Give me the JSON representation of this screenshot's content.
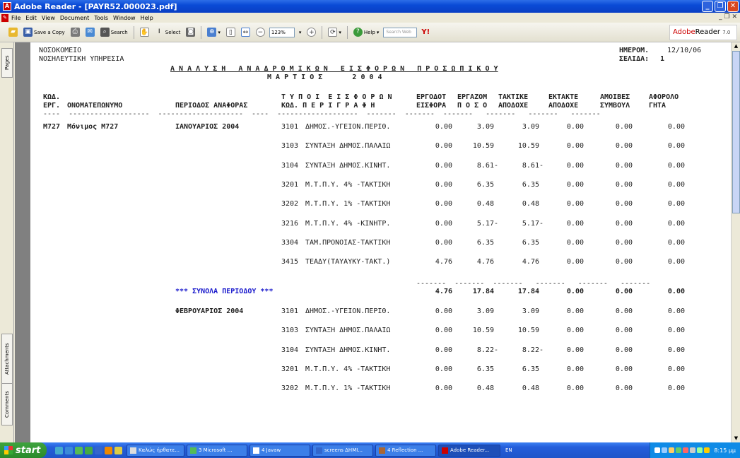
{
  "window": {
    "title": "Adobe Reader - [PAYR52.000023.pdf]",
    "buttons": {
      "minimize": "_",
      "maximize": "❐",
      "close": "✕"
    }
  },
  "menu": {
    "items": [
      "File",
      "Edit",
      "View",
      "Document",
      "Tools",
      "Window",
      "Help"
    ],
    "right_controls": "_ ❐ ✕"
  },
  "toolbar": {
    "save_copy": "Save a Copy",
    "search": "Search",
    "select": "Select",
    "zoom_value": "123%",
    "help": "Help",
    "search_web_placeholder": "Search Web",
    "brand": "Adobe",
    "brand_product": "Reader",
    "brand_version": "7.0"
  },
  "side_tabs": {
    "pages": "Pages",
    "attachments": "Attachments",
    "comments": "Comments"
  },
  "document": {
    "header_left_1": "ΝΟΣΟΚΟΜΕΙΟ",
    "header_left_2": "ΝΟΣΗΛΕΥΤΙΚΗ ΥΠΗΡΕΣΙΑ",
    "date_label": "ΗΜΕΡΟΜ.",
    "date_value": "12/10/06",
    "page_label": "ΣΕΛΙΔΑ:",
    "page_value": "1",
    "title": "Α Ν Α Λ Υ Σ Η   Α Ν Α Δ Ρ Ο Μ Ι Κ Ω Ν   Ε Ι Σ Φ Ο Ρ Ω Ν   Π Ρ Ο Σ Ω Π Ι Κ Ο Υ",
    "subtitle": "Μ Α Ρ Τ Ι Ο Σ       2 0 0 4",
    "col_headers": {
      "c1a": "ΚΩΔ.",
      "c1b": "ΕΡΓ.",
      "c2": "ΟΝΟΜΑΤΕΠΩΝΥΜΟ",
      "c3": "ΠΕΡΙΟΔΟΣ ΑΝΑΦΟΡΑΣ",
      "c4a": "Τ Υ Π Ο Ι  Ε Ι Σ Φ Ο Ρ Ω Ν",
      "c4b": "ΚΩΔ. Π Ε Ρ Ι Γ Ρ Α Φ Η",
      "c5a": "ΕΡΓΟΔΟΤ",
      "c5b": "ΕΙΣΦΟΡΑ",
      "c6a": "ΕΡΓΑΖΟΜ",
      "c6b": "Π Ο Σ Ο",
      "c7a": "ΤΑΚΤΙΚΕ",
      "c7b": "ΑΠΟΔΟΧΕ",
      "c8a": "ΕΚΤΑΚΤΕ",
      "c8b": "ΑΠΟΔΟΧΕ",
      "c9a": "ΑΜΟΙΒΕΣ",
      "c9b": "ΣΥΜΒΟΥΛ",
      "c10a": "ΑΦΟΡΟΛΟ",
      "c10b": "ΓΗΤΑ"
    },
    "dash_line": "----  -------------------  --------------------  ----  -------------------  -------  -------  -------   -------   -------   -------",
    "employee_code": "Μ727",
    "employee_name": "Μόνιμος Μ727",
    "period_1": "ΙΑΝΟΥΑΡΙΟΣ 2004",
    "period_2": "ΦΕΒΡΟΥΑΡΙΟΣ 2004",
    "rows_p1": [
      {
        "code": "3101",
        "desc": "ΔΗΜΟΣ.-ΥΓΕΙΟΝ.ΠΕΡΙΘ.",
        "erg": "0.00",
        "poso": "3.09",
        "takt": "3.09",
        "ekt": "0.00",
        "amoib": "0.00",
        "afor": "0.00"
      },
      {
        "code": "3103",
        "desc": "ΣΥΝΤΑΞΗ ΔΗΜΟΣ.ΠΑΛΑΙΩ",
        "erg": "0.00",
        "poso": "10.59",
        "takt": "10.59",
        "ekt": "0.00",
        "amoib": "0.00",
        "afor": "0.00"
      },
      {
        "code": "3104",
        "desc": "ΣΥΝΤΑΞΗ ΔΗΜΟΣ.ΚΙΝΗΤ.",
        "erg": "0.00",
        "poso": "8.61-",
        "takt": "8.61-",
        "ekt": "0.00",
        "amoib": "0.00",
        "afor": "0.00"
      },
      {
        "code": "3201",
        "desc": "Μ.Τ.Π.Υ. 4% -ΤΑΚΤΙΚΗ",
        "erg": "0.00",
        "poso": "6.35",
        "takt": "6.35",
        "ekt": "0.00",
        "amoib": "0.00",
        "afor": "0.00"
      },
      {
        "code": "3202",
        "desc": "Μ.Τ.Π.Υ. 1% -ΤΑΚΤΙΚΗ",
        "erg": "0.00",
        "poso": "0.48",
        "takt": "0.48",
        "ekt": "0.00",
        "amoib": "0.00",
        "afor": "0.00"
      },
      {
        "code": "3216",
        "desc": "Μ.Τ.Π.Υ. 4% -ΚΙΝΗΤΡ.",
        "erg": "0.00",
        "poso": "5.17-",
        "takt": "5.17-",
        "ekt": "0.00",
        "amoib": "0.00",
        "afor": "0.00"
      },
      {
        "code": "3304",
        "desc": "ΤΑΜ.ΠΡΟΝΟΙΑΣ-ΤΑΚΤΙΚΗ",
        "erg": "0.00",
        "poso": "6.35",
        "takt": "6.35",
        "ekt": "0.00",
        "amoib": "0.00",
        "afor": "0.00"
      },
      {
        "code": "3415",
        "desc": "ΤΕΑΔΥ(ΤΑΥΑΥΚΥ-ΤΑΚΤ.)",
        "erg": "4.76",
        "poso": "4.76",
        "takt": "4.76",
        "ekt": "0.00",
        "amoib": "0.00",
        "afor": "0.00"
      }
    ],
    "total_dashes": "-------  -------  -------   -------   -------   -------",
    "total_label": "*** ΣΥΝΟΛΑ ΠΕΡΙΟΔΟΥ ***",
    "totals": {
      "erg": "4.76",
      "poso": "17.84",
      "takt": "17.84",
      "ekt": "0.00",
      "amoib": "0.00",
      "afor": "0.00"
    },
    "rows_p2": [
      {
        "code": "3101",
        "desc": "ΔΗΜΟΣ.-ΥΓΕΙΟΝ.ΠΕΡΙΘ.",
        "erg": "0.00",
        "poso": "3.09",
        "takt": "3.09",
        "ekt": "0.00",
        "amoib": "0.00",
        "afor": "0.00"
      },
      {
        "code": "3103",
        "desc": "ΣΥΝΤΑΞΗ ΔΗΜΟΣ.ΠΑΛΑΙΩ",
        "erg": "0.00",
        "poso": "10.59",
        "takt": "10.59",
        "ekt": "0.00",
        "amoib": "0.00",
        "afor": "0.00"
      },
      {
        "code": "3104",
        "desc": "ΣΥΝΤΑΞΗ ΔΗΜΟΣ.ΚΙΝΗΤ.",
        "erg": "0.00",
        "poso": "8.22-",
        "takt": "8.22-",
        "ekt": "0.00",
        "amoib": "0.00",
        "afor": "0.00"
      },
      {
        "code": "3201",
        "desc": "Μ.Τ.Π.Υ. 4% -ΤΑΚΤΙΚΗ",
        "erg": "0.00",
        "poso": "6.35",
        "takt": "6.35",
        "ekt": "0.00",
        "amoib": "0.00",
        "afor": "0.00"
      },
      {
        "code": "3202",
        "desc": "Μ.Τ.Π.Υ. 1% -ΤΑΚΤΙΚΗ",
        "erg": "0.00",
        "poso": "0.48",
        "takt": "0.48",
        "ekt": "0.00",
        "amoib": "0.00",
        "afor": "0.00"
      }
    ]
  },
  "taskbar": {
    "start": "start",
    "tasks": [
      "Καλώς ήρθατε...",
      "3 Microsoft ...",
      "4 Javaw",
      "screens ΔΗΜΙ...",
      "4 Reflection ...",
      "Adobe Reader..."
    ],
    "lang": "EN",
    "clock": "8:15 μμ"
  },
  "colors": {
    "accent_blue": "#1a1acc",
    "title_bar": "#0a4bd6",
    "start_green": "#3ea33e"
  }
}
